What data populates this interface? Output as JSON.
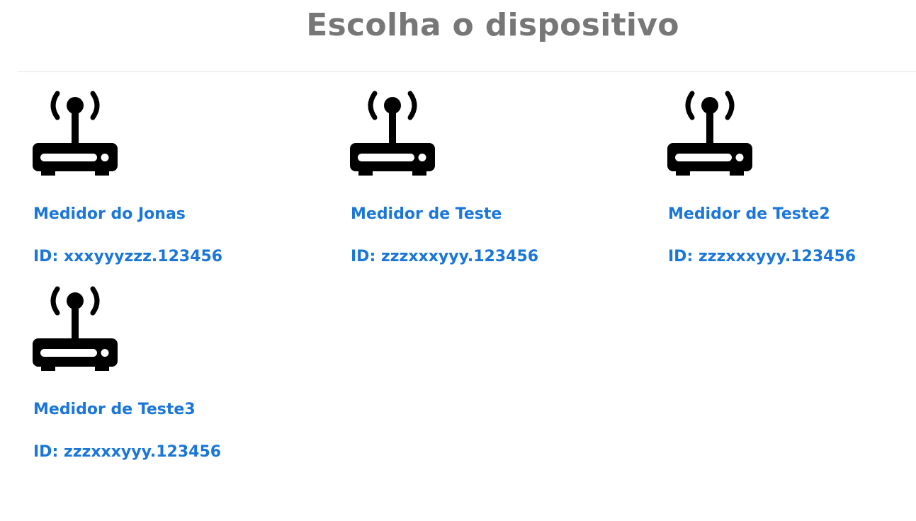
{
  "page": {
    "title": "Escolha o dispositivo"
  },
  "theme": {
    "link_color": "#1a76d9",
    "title_color": "#777777",
    "icon_color": "#000000"
  },
  "devices": [
    {
      "name": "Medidor do Jonas",
      "id": "ID: xxxyyyzzz.123456",
      "icon": "router-icon"
    },
    {
      "name": "Medidor de Teste",
      "id": "ID: zzzxxxyyy.123456",
      "icon": "router-icon"
    },
    {
      "name": "Medidor de Teste2",
      "id": "ID: zzzxxxyyy.123456",
      "icon": "router-icon"
    },
    {
      "name": "Medidor de Teste3",
      "id": "ID: zzzxxxyyy.123456",
      "icon": "router-icon"
    }
  ]
}
